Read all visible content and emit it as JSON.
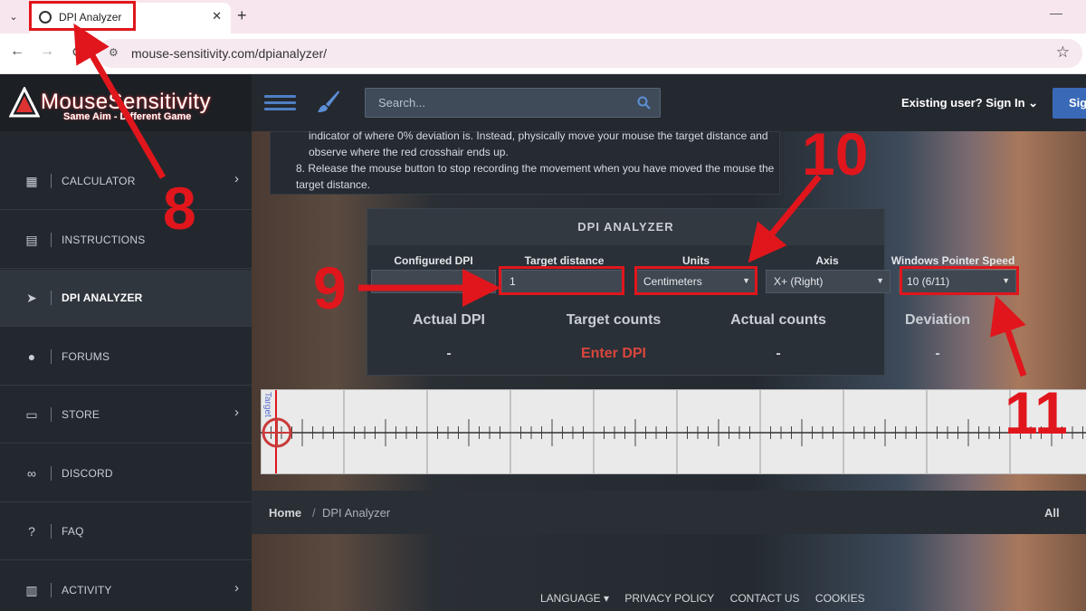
{
  "browser": {
    "tab_title": "DPI Analyzer",
    "tab_close": "✕",
    "new_tab": "+",
    "minimize": "—",
    "url": "mouse-sensitivity.com/dpianalyzer/"
  },
  "header": {
    "logo_title": "MouseSensitivity",
    "logo_tagline": "Same Aim - Different Game",
    "search_placeholder": "Search...",
    "signin_label": "Existing user? Sign In ⌄",
    "signup_label": "Sig"
  },
  "sidebar": {
    "items": [
      {
        "label": "CALCULATOR",
        "icon": "calculator-icon"
      },
      {
        "label": "INSTRUCTIONS",
        "icon": "book-icon"
      },
      {
        "label": "DPI ANALYZER",
        "icon": "cursor-icon"
      },
      {
        "label": "FORUMS",
        "icon": "chat-icon"
      },
      {
        "label": "STORE",
        "icon": "cart-icon"
      },
      {
        "label": "DISCORD",
        "icon": "link-icon"
      },
      {
        "label": "FAQ",
        "icon": "question-icon"
      },
      {
        "label": "ACTIVITY",
        "icon": "bar-chart-icon"
      }
    ],
    "active": "DPI ANALYZER"
  },
  "instructions": {
    "partial": "indicator of where 0% deviation is. Instead, physically move your mouse the target distance and observe where the red crosshair ends up.",
    "step8": "8. Release the mouse button to stop recording the movement when you have moved the mouse the target distance."
  },
  "analyzer": {
    "title": "DPI ANALYZER",
    "labels": {
      "configured_dpi": "Configured DPI",
      "target_distance": "Target distance",
      "units": "Units",
      "axis": "Axis",
      "pointer_speed": "Windows Pointer Speed"
    },
    "values": {
      "configured_dpi": "",
      "target_distance": "1",
      "units": "Centimeters",
      "axis": "X+ (Right)",
      "pointer_speed": "10 (6/11)"
    },
    "results": {
      "actual_dpi": "Actual DPI",
      "target_counts": "Target counts",
      "actual_counts": "Actual counts",
      "deviation": "Deviation",
      "actual_dpi_val": "-",
      "target_counts_val": "Enter DPI",
      "actual_counts_val": "-",
      "deviation_val": "-"
    },
    "ruler_target_label": "Target"
  },
  "breadcrumb": {
    "home": "Home",
    "separator": "/",
    "current": "DPI Analyzer",
    "all": "All"
  },
  "footer": {
    "language": "LANGUAGE ▾",
    "privacy": "PRIVACY POLICY",
    "contact": "CONTACT US",
    "cookies": "COOKIES"
  },
  "annotations": {
    "n8": "8",
    "n9": "9",
    "n10": "10",
    "n11": "11"
  },
  "colors": {
    "annotation_red": "#e0161c",
    "accent_blue": "#3a69b8",
    "enter_dpi_red": "#d9463c"
  }
}
